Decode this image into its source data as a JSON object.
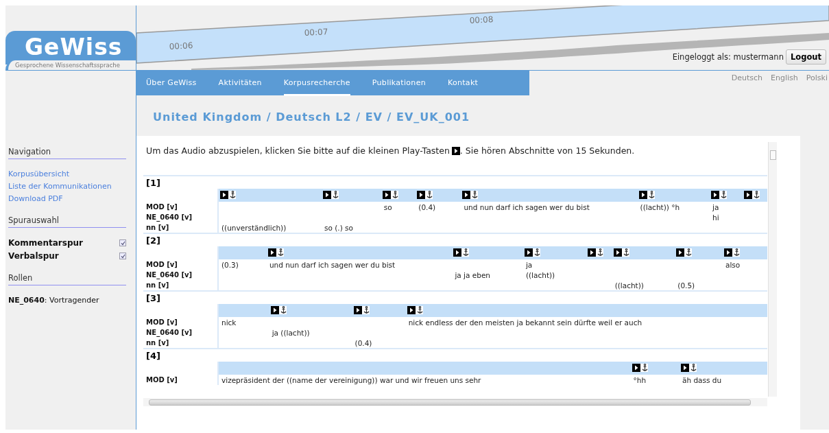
{
  "logo": {
    "name": "GeWiss",
    "tagline": "Gesprochene Wissenschaftssprache"
  },
  "timeline": {
    "ticks": [
      "00:06",
      "00:07",
      "00:08"
    ]
  },
  "login": {
    "text": "Eingeloggt als: mustermann",
    "button": "Logout"
  },
  "nav": [
    {
      "label": "Über GeWiss",
      "selected": false
    },
    {
      "label": "Aktivitäten",
      "selected": false
    },
    {
      "label": "Korpusrecherche",
      "selected": true
    },
    {
      "label": "Publikationen",
      "selected": false
    },
    {
      "label": "Kontakt",
      "selected": false
    }
  ],
  "languages": [
    "Deutsch",
    "English",
    "Polski"
  ],
  "breadcrumb": "United Kingdom / Deutsch L2 / EV / EV_UK_001",
  "sidebar": [
    {
      "heading": "Navigation",
      "kind": "links",
      "items": [
        {
          "label": "Korpusübersicht"
        },
        {
          "label": "Liste der Kommunikationen"
        },
        {
          "label": "Download PDF"
        }
      ]
    },
    {
      "heading": "Spurauswahl",
      "kind": "checks",
      "items": [
        {
          "label": "Kommentarspur",
          "checked": true
        },
        {
          "label": "Verbalspur",
          "checked": true
        }
      ]
    },
    {
      "heading": "Rollen",
      "kind": "roles",
      "items": [
        {
          "label": "**NE_0640**: Vortragender"
        }
      ]
    }
  ],
  "intro": {
    "before": "Um das Audio abzuspielen, klicken Sie bitte auf die kleinen Play-Tasten",
    "after": ". Sie hören Abschnitte von 15 Sekunden."
  },
  "blocks": [
    {
      "number": "[1]",
      "tiers": [
        "MOD [v]",
        "NE_0640 [v]",
        "nn [v]"
      ],
      "columns": [
        {
          "marker": true,
          "cells": [
            "",
            "",
            "((unverständlich))"
          ]
        },
        {
          "marker": true,
          "cells": [
            "",
            "",
            "so (.) so"
          ]
        },
        {
          "marker": true,
          "cells": [
            "so",
            "",
            ""
          ]
        },
        {
          "marker": true,
          "cells": [
            "(0.4)",
            "",
            ""
          ]
        },
        {
          "marker": true,
          "cells": [
            "und nun darf ich sagen wer du bist",
            "",
            ""
          ]
        },
        {
          "marker": true,
          "cells": [
            "((lacht)) °h",
            "",
            ""
          ]
        },
        {
          "marker": true,
          "cells": [
            "ja",
            "hi",
            ""
          ]
        },
        {
          "marker": true,
          "cells": [
            "",
            "",
            ""
          ]
        }
      ]
    },
    {
      "number": "[2]",
      "tiers": [
        "MOD [v]",
        "NE_0640 [v]",
        "nn [v]"
      ],
      "columns": [
        {
          "marker": false,
          "cells": [
            "(0.3)",
            "",
            ""
          ]
        },
        {
          "marker": true,
          "cells": [
            "und nun darf ich sagen wer du bist",
            "",
            ""
          ]
        },
        {
          "marker": true,
          "cells": [
            "",
            "ja ja eben",
            ""
          ]
        },
        {
          "marker": true,
          "cells": [
            "ja",
            "((lacht))",
            ""
          ]
        },
        {
          "marker": true,
          "cells": [
            "",
            "",
            ""
          ]
        },
        {
          "marker": true,
          "cells": [
            "",
            "",
            "((lacht))"
          ]
        },
        {
          "marker": true,
          "cells": [
            "",
            "",
            "(0.5)"
          ]
        },
        {
          "marker": true,
          "cells": [
            "also",
            "",
            ""
          ]
        }
      ]
    },
    {
      "number": "[3]",
      "tiers": [
        "MOD [v]",
        "NE_0640 [v]",
        "nn [v]"
      ],
      "columns": [
        {
          "marker": false,
          "cells": [
            "nick",
            "",
            ""
          ]
        },
        {
          "marker": true,
          "cells": [
            "",
            "ja ((lacht))",
            ""
          ]
        },
        {
          "marker": true,
          "cells": [
            "",
            "",
            "(0.4)"
          ]
        },
        {
          "marker": true,
          "cells": [
            "nick endless der den meisten ja bekannt sein dürfte weil er auch",
            "",
            ""
          ]
        }
      ]
    },
    {
      "number": "[4]",
      "tiers": [
        "MOD [v]"
      ],
      "columns": [
        {
          "marker": false,
          "cells": [
            "vizepräsident der ((name der vereinigung)) war und wir freuen uns sehr"
          ]
        },
        {
          "marker": true,
          "cells": [
            "°hh"
          ]
        },
        {
          "marker": true,
          "cells": [
            "äh dass du"
          ]
        }
      ]
    }
  ]
}
